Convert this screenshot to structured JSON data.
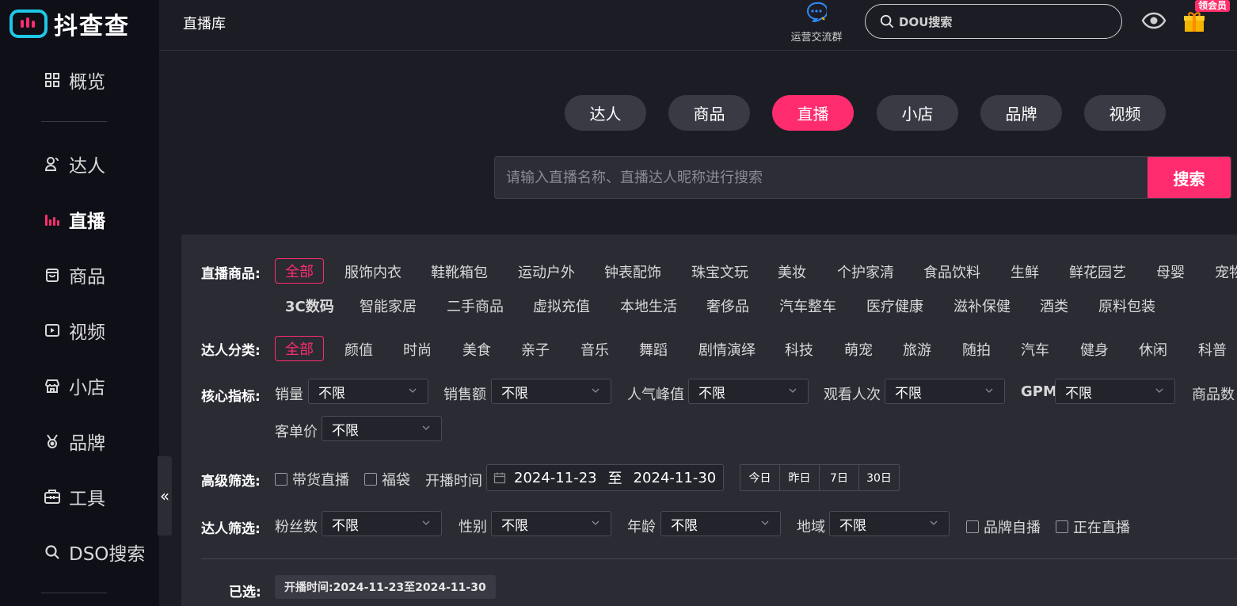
{
  "app": {
    "name": "抖查查"
  },
  "sidebar": {
    "items": [
      {
        "label": "概览",
        "icon": "grid-icon"
      },
      {
        "label": "达人",
        "icon": "user-icon"
      },
      {
        "label": "直播",
        "icon": "bars-icon",
        "active": true
      },
      {
        "label": "商品",
        "icon": "bag-icon"
      },
      {
        "label": "视频",
        "icon": "play-icon"
      },
      {
        "label": "小店",
        "icon": "store-icon"
      },
      {
        "label": "品牌",
        "icon": "medal-icon"
      },
      {
        "label": "工具",
        "icon": "toolbox-icon"
      },
      {
        "label": "DSO搜索",
        "icon": "search-icon"
      }
    ],
    "collapse_label": "«"
  },
  "topbar": {
    "title": "直播库",
    "ops_group_label": "运营交流群",
    "dou_search_placeholder": "DOU搜索",
    "vip_label": "领会员"
  },
  "categories": [
    "达人",
    "商品",
    "直播",
    "小店",
    "品牌",
    "视频"
  ],
  "active_category": "直播",
  "search": {
    "placeholder": "请输入直播名称、直播达人昵称进行搜索",
    "button": "搜索"
  },
  "filters": {
    "goods": {
      "label": "直播商品:",
      "row1": [
        "全部",
        "服饰内衣",
        "鞋靴箱包",
        "运动户外",
        "钟表配饰",
        "珠宝文玩",
        "美妆",
        "个护家清",
        "食品饮料",
        "生鲜",
        "鲜花园艺",
        "母婴",
        "宠物"
      ],
      "row2": [
        "3C数码",
        "智能家居",
        "二手商品",
        "虚拟充值",
        "本地生活",
        "奢侈品",
        "汽车整车",
        "医疗健康",
        "滋补保健",
        "酒类",
        "原料包装"
      ]
    },
    "talent_category": {
      "label": "达人分类:",
      "items": [
        "全部",
        "颜值",
        "时尚",
        "美食",
        "亲子",
        "音乐",
        "舞蹈",
        "剧情演绎",
        "科技",
        "萌宠",
        "旅游",
        "随拍",
        "汽车",
        "健身",
        "休闲",
        "科普"
      ]
    },
    "core": {
      "label": "核心指标:",
      "fields": [
        "销量",
        "销售额",
        "人气峰值",
        "观看人次",
        "GPM",
        "商品数",
        "客单价"
      ],
      "default_value": "不限"
    },
    "advanced": {
      "label": "高级筛选:",
      "check_live_goods": "带货直播",
      "check_lucky_bag": "福袋",
      "start_time_label": "开播时间",
      "date_from": "2024-11-23",
      "date_sep": "至",
      "date_to": "2024-11-30",
      "quick": [
        "今日",
        "昨日",
        "7日",
        "30日"
      ]
    },
    "talent_filter": {
      "label": "达人筛选:",
      "fields": [
        "粉丝数",
        "性别",
        "年龄",
        "地域"
      ],
      "default_value": "不限",
      "check_brand_self": "品牌自播",
      "check_live_now": "正在直播"
    },
    "selected": {
      "label": "已选:",
      "tag": "开播时间:2024-11-23至2024-11-30"
    }
  },
  "colors": {
    "accent": "#fe2c6e",
    "bg": "#1c1d24",
    "sidebar": "#0e0f17",
    "panel": "#2a2b33"
  }
}
